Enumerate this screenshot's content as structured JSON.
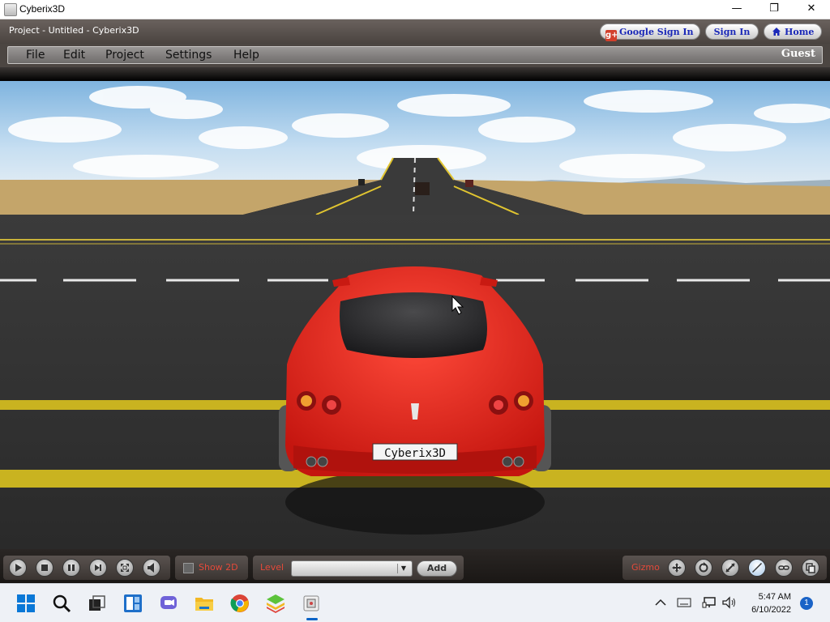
{
  "window": {
    "title": "Cyberix3D"
  },
  "header": {
    "project_title": "Project - Untitled - Cyberix3D",
    "google_sign_in": "Google Sign In",
    "google_glyph": "g+",
    "sign_in": "Sign In",
    "home": "Home"
  },
  "menu": {
    "items": [
      "File",
      "Edit",
      "Project",
      "Settings",
      "Help"
    ],
    "user": "Guest"
  },
  "scene": {
    "plate_text": "Cyberix3D"
  },
  "toolbar": {
    "show2d_label": "Show 2D",
    "level_label": "Level",
    "level_value": "",
    "add_label": "Add",
    "gizmo_label": "Gizmo"
  },
  "taskbar": {
    "time": "5:47 AM",
    "date": "6/10/2022",
    "notifications": "1"
  },
  "colors": {
    "accent_red": "#e44a3a",
    "link_blue": "#1a28b8",
    "car_red": "#d61f1f"
  }
}
